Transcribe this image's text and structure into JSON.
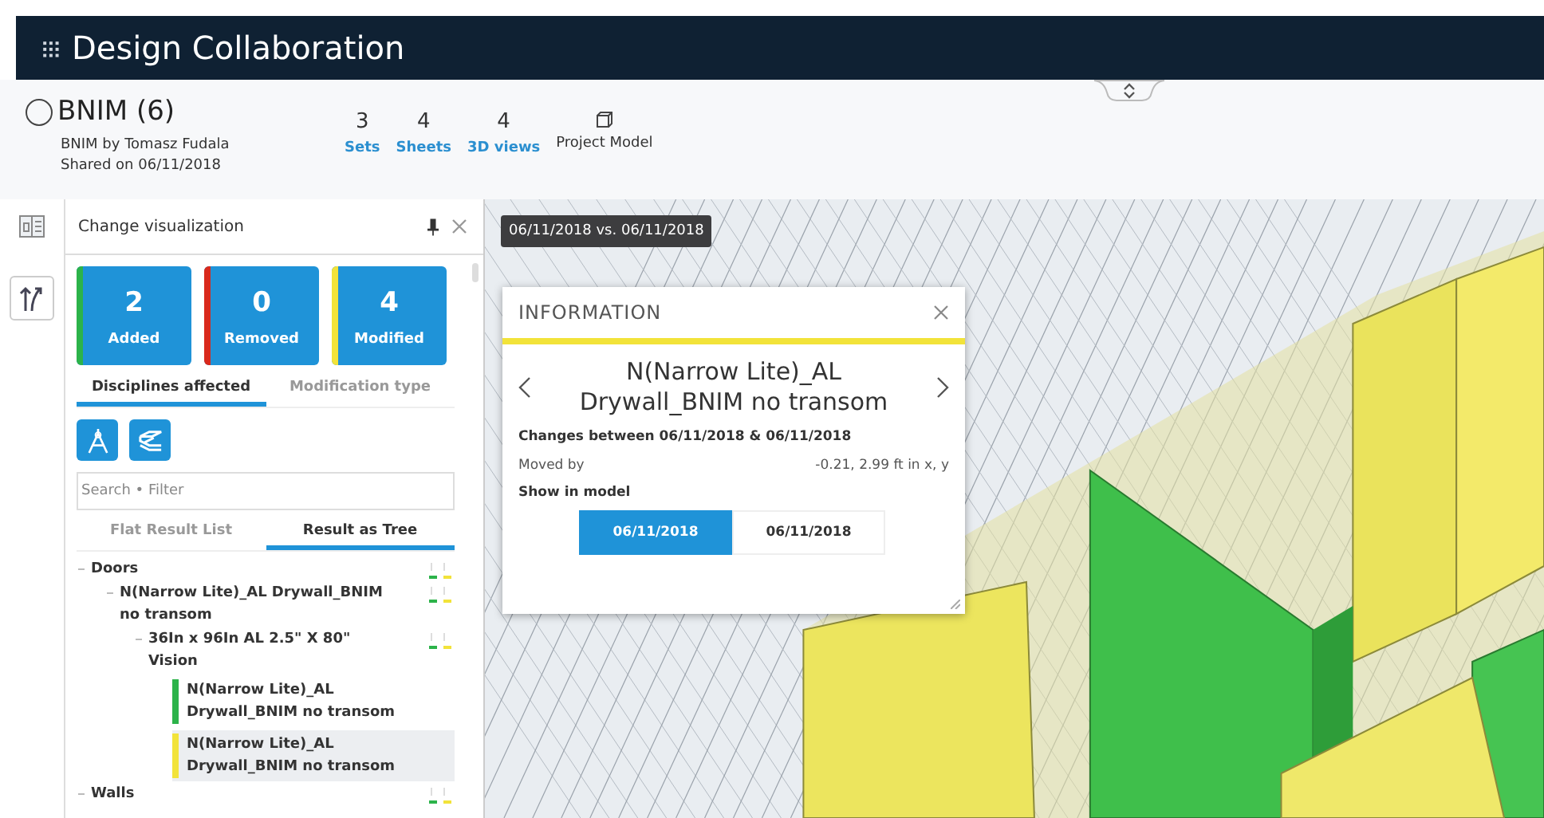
{
  "header": {
    "title": "Design Collaboration"
  },
  "package": {
    "name": "BNIM (6)",
    "owner": "BNIM by Tomasz Fudala",
    "shared": "Shared on 06/11/2018",
    "stats": [
      {
        "count": "3",
        "label": "Sets"
      },
      {
        "count": "4",
        "label": "Sheets"
      },
      {
        "count": "4",
        "label": "3D views"
      }
    ],
    "project_model": "Project Model"
  },
  "panel": {
    "title": "Change visualization",
    "summary": [
      {
        "count": "2",
        "label": "Added",
        "color": "#2cb34a"
      },
      {
        "count": "0",
        "label": "Removed",
        "color": "#d9291c"
      },
      {
        "count": "4",
        "label": "Modified",
        "color": "#f2e33a"
      }
    ],
    "tabs": [
      {
        "label": "Disciplines affected",
        "selected": true
      },
      {
        "label": "Modification type",
        "selected": false
      }
    ],
    "search": {
      "placeholder": "Search • Filter"
    },
    "view_tabs": [
      {
        "label": "Flat Result List",
        "selected": false
      },
      {
        "label": "Result as Tree",
        "selected": true
      }
    ],
    "tree": [
      {
        "label": "Doors",
        "expanded": true,
        "children": [
          {
            "label": "N(Narrow Lite)_AL Drywall_BNIM no transom",
            "expanded": true,
            "children": [
              {
                "label": "36In x 96In AL 2.5\" X 80\" Vision",
                "expanded": true,
                "children": [
                  {
                    "label": "N(Narrow Lite)_AL Drywall_BNIM no transom",
                    "color": "#2cb34a",
                    "selected": false
                  },
                  {
                    "label": "N(Narrow Lite)_AL Drywall_BNIM no transom",
                    "color": "#f2e33a",
                    "selected": true
                  }
                ]
              }
            ]
          }
        ]
      },
      {
        "label": "Walls",
        "expanded": true
      }
    ]
  },
  "viewer": {
    "comparison_label": "06/11/2018 vs. 06/11/2018",
    "info": {
      "title": "INFORMATION",
      "element_name": "N(Narrow Lite)_AL Drywall_BNIM no transom",
      "changes": "Changes between 06/11/2018 & 06/11/2018",
      "property": {
        "label": "Moved by",
        "value": "-0.21, 2.99 ft in x, y"
      },
      "show_label": "Show in model",
      "versions": [
        {
          "label": "06/11/2018",
          "selected": true
        },
        {
          "label": "06/11/2018",
          "selected": false
        }
      ]
    }
  }
}
